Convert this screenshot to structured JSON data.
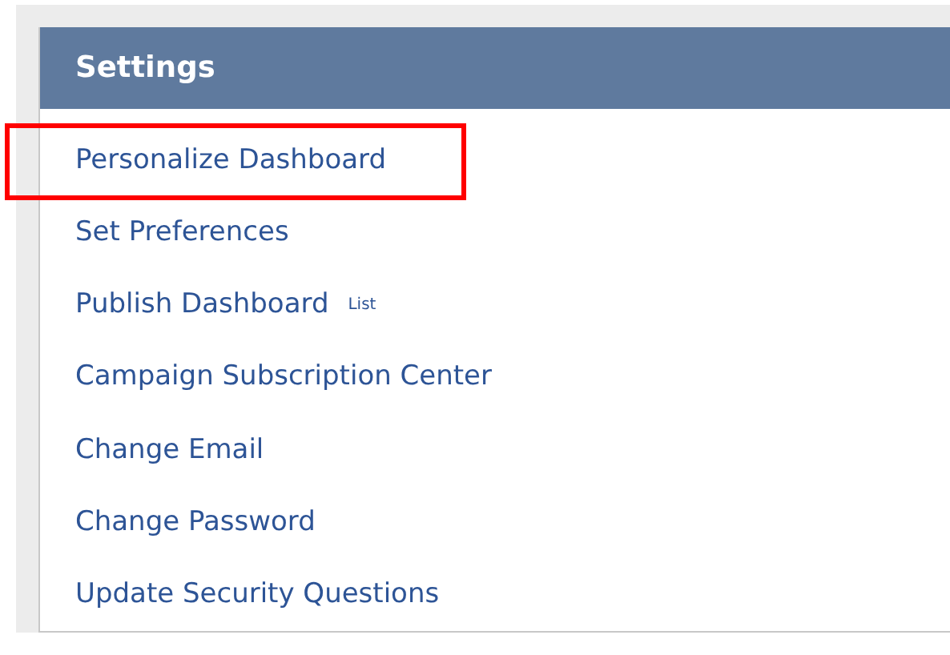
{
  "panel": {
    "title": "Settings"
  },
  "items": [
    {
      "label": "Personalize Dashboard",
      "highlighted": true
    },
    {
      "label": "Set Preferences",
      "highlighted": false
    },
    {
      "label": "Publish Dashboard",
      "tag": "List",
      "highlighted": false
    },
    {
      "label": "Campaign Subscription Center",
      "highlighted": false
    },
    {
      "label": "Change Email",
      "highlighted": false
    },
    {
      "label": "Change Password",
      "highlighted": false
    },
    {
      "label": "Update Security Questions",
      "highlighted": false
    }
  ]
}
